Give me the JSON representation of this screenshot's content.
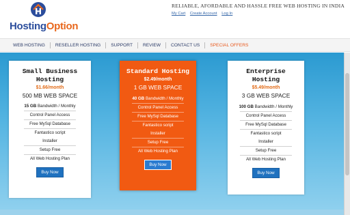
{
  "header": {
    "logo_part1": "Hosting",
    "logo_part2": "Option",
    "tagline": "RELIABLE, AFORDABLE AND HASSLE FREE WEB HOSTING IN INDIA",
    "links": [
      "My Cart",
      "Create Account",
      "Log In"
    ]
  },
  "nav": {
    "items": [
      "WEB HOSTING",
      "RESELLER HOSTING",
      "SUPPORT",
      "REVIEW",
      "CONTACT US"
    ],
    "special": "SPECIAL OFFERS"
  },
  "plans": [
    {
      "name": "Small Business Hosting",
      "price": "$1.66/month",
      "space": "500 MB WEB SPACE",
      "bandwidth_bold": "15 GB",
      "bandwidth_rest": " Bandwidth / Monthly",
      "features": [
        "Control Panel Access",
        "Free MySql Database",
        "Fantastico script Installer",
        "Setup Free",
        "All Web Hosting Plan"
      ],
      "button": "Buy Now"
    },
    {
      "name": "Standard Hosting",
      "price": "$2.49/month",
      "space": "1 GB WEB SPACE",
      "bandwidth_bold": "40 GB",
      "bandwidth_rest": " Bandwidth / Monthly",
      "features": [
        "Control Panel Access",
        "Free MySql Database",
        "Fantastico script Installer",
        "Setup Free",
        "All Web Hosting Plan"
      ],
      "button": "Buy Now"
    },
    {
      "name": "Enterprise Hosting",
      "price": "$5.49/month",
      "space": "3 GB WEB SPACE",
      "bandwidth_bold": "100 GB",
      "bandwidth_rest": " Bandwidth / Monthly",
      "features": [
        "Control Panel Access",
        "Free MySql Database",
        "Fantastico script Installer",
        "Setup Free",
        "All Web Hosting Plan"
      ],
      "button": "Buy Now"
    }
  ],
  "colors": {
    "brand_blue": "#2b4d9c",
    "brand_orange": "#e8671c",
    "featured_card": "#f15a12",
    "button_blue": "#1f71bf",
    "background_blue": "#2b9ad1"
  },
  "icons": {
    "logo": "house-H-logo-icon"
  }
}
